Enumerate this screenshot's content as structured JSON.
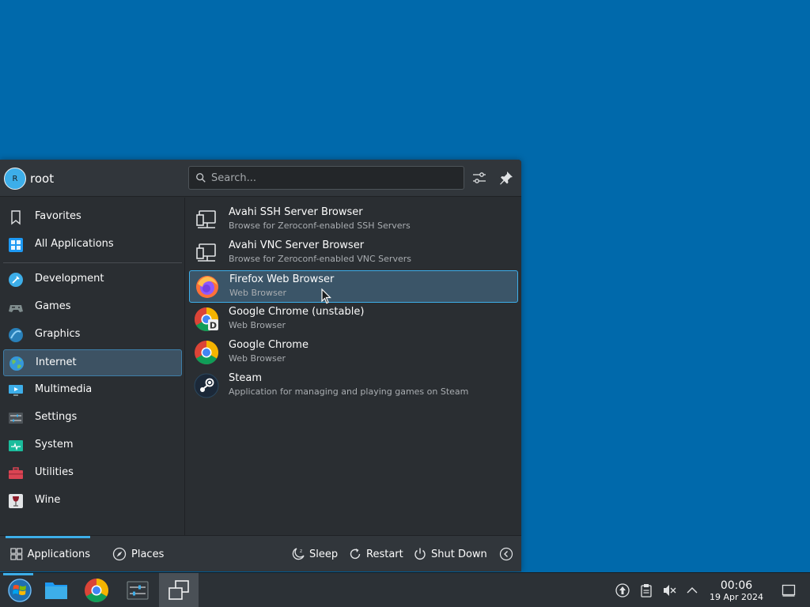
{
  "user": {
    "initial": "R",
    "name": "root"
  },
  "search": {
    "placeholder": "Search..."
  },
  "sidebar": {
    "items": [
      {
        "label": "Favorites"
      },
      {
        "label": "All Applications"
      },
      {
        "label": "Development"
      },
      {
        "label": "Games"
      },
      {
        "label": "Graphics"
      },
      {
        "label": "Internet"
      },
      {
        "label": "Multimedia"
      },
      {
        "label": "Settings"
      },
      {
        "label": "System"
      },
      {
        "label": "Utilities"
      },
      {
        "label": "Wine"
      }
    ],
    "active": "Internet"
  },
  "apps": [
    {
      "name": "Avahi SSH Server Browser",
      "desc": "Browse for Zeroconf-enabled SSH Servers",
      "icon": "network-monitor-icon"
    },
    {
      "name": "Avahi VNC Server Browser",
      "desc": "Browse for Zeroconf-enabled VNC Servers",
      "icon": "network-monitor-icon"
    },
    {
      "name": "Firefox Web Browser",
      "desc": "Web Browser",
      "icon": "firefox-icon"
    },
    {
      "name": "Google Chrome (unstable)",
      "desc": "Web Browser",
      "icon": "chrome-dev-icon"
    },
    {
      "name": "Google Chrome",
      "desc": "Web Browser",
      "icon": "chrome-icon"
    },
    {
      "name": "Steam",
      "desc": "Application for managing and playing games on Steam",
      "icon": "steam-icon"
    }
  ],
  "footer": {
    "applications": "Applications",
    "places": "Places",
    "sleep": "Sleep",
    "restart": "Restart",
    "shutdown": "Shut Down"
  },
  "clock": {
    "time": "00:06",
    "date": "19 Apr 2024"
  },
  "colors": {
    "accent": "#3daee9",
    "desktop": "#0067a8",
    "panel": "#2a2e32"
  }
}
